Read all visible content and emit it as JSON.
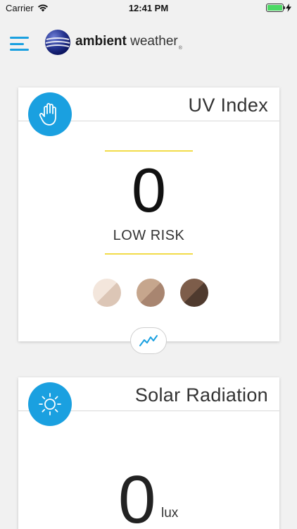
{
  "status_bar": {
    "carrier": "Carrier",
    "time": "12:41 PM",
    "battery_level": 1.0
  },
  "header": {
    "logo_text_bold": "ambient",
    "logo_text_light": "weather",
    "logo_reg": "®",
    "icons": [
      "hamburger-menu-icon",
      "ambient-weather-logo"
    ]
  },
  "uv_card": {
    "title": "UV Index",
    "icon": "hand-icon",
    "value": "0",
    "risk_label": "LOW RISK",
    "skin_tones": [
      {
        "light": "#f3e6dc",
        "dark": "#dcc6b6"
      },
      {
        "light": "#c6a68d",
        "dark": "#a88570"
      },
      {
        "light": "#7d5d4a",
        "dark": "#4f3a2e"
      }
    ],
    "chart_icon": "trend-chart-icon"
  },
  "solar_card": {
    "title": "Solar Radiation",
    "icon": "sun-icon",
    "value": "0",
    "unit": "lux"
  },
  "colors": {
    "accent": "#1aa0e0",
    "divider_yellow": "#f2dc4a",
    "background": "#f1f1f1"
  }
}
